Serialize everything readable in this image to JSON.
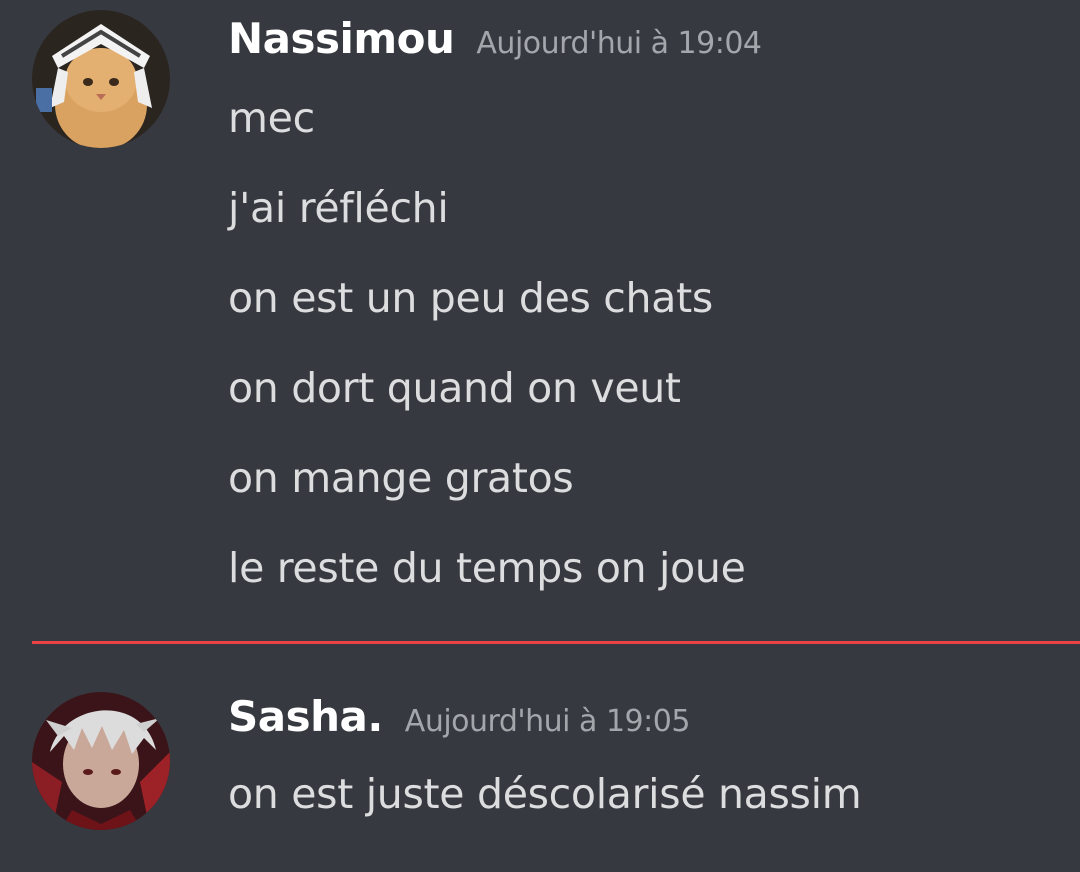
{
  "messages": [
    {
      "username": "Nassimou",
      "timestamp": "Aujourd'hui à 19:04",
      "lines": [
        "mec",
        "j'ai réfléchi",
        "on est un peu des chats",
        "on dort quand on veut",
        "on mange gratos",
        "le reste du temps on joue"
      ]
    },
    {
      "username": "Sasha.",
      "timestamp": "Aujourd'hui à 19:05",
      "lines": [
        "on est juste déscolarisé nassim"
      ]
    }
  ],
  "colors": {
    "background": "#36393f",
    "username": "#ffffff",
    "timestamp": "#a3a6aa",
    "message_text": "#dcddde",
    "new_messages_divider": "#ed4245"
  }
}
